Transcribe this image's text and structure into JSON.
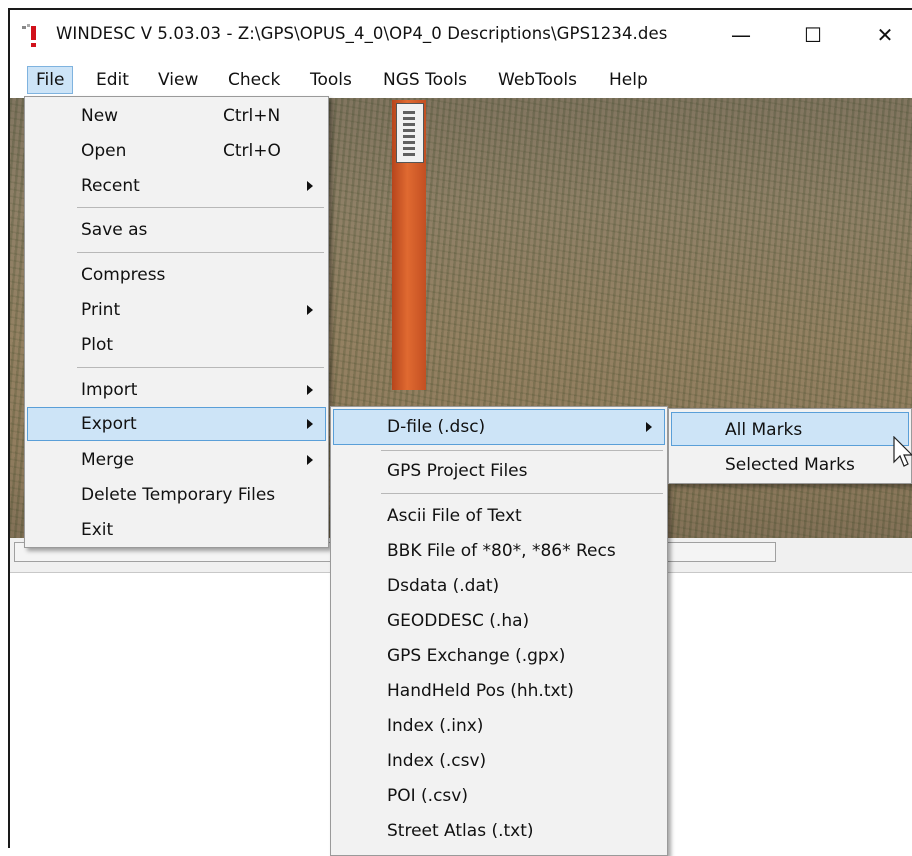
{
  "window": {
    "title": "WINDESC V 5.03.03 - Z:\\GPS\\OPUS_4_0\\OP4_0 Descriptions\\GPS1234.des",
    "icon": "app-exclamation-icon",
    "controls": {
      "minimize": "—",
      "maximize": "☐",
      "close": "✕"
    }
  },
  "menubar": {
    "items": [
      {
        "label": "File"
      },
      {
        "label": "Edit"
      },
      {
        "label": "View"
      },
      {
        "label": "Check"
      },
      {
        "label": "Tools"
      },
      {
        "label": "NGS Tools"
      },
      {
        "label": "WebTools"
      },
      {
        "label": "Help"
      }
    ]
  },
  "file_menu": {
    "items": [
      {
        "label": "New",
        "shortcut": "Ctrl+N"
      },
      {
        "label": "Open",
        "shortcut": "Ctrl+O"
      },
      {
        "label": "Recent"
      },
      {
        "label": "Save as"
      },
      {
        "label": "Compress"
      },
      {
        "label": "Print"
      },
      {
        "label": "Plot"
      },
      {
        "label": "Import"
      },
      {
        "label": "Export"
      },
      {
        "label": "Merge"
      },
      {
        "label": "Delete Temporary Files"
      },
      {
        "label": "Exit"
      }
    ]
  },
  "export_menu": {
    "items": [
      {
        "label": "D-file (.dsc)"
      },
      {
        "label": "GPS Project Files"
      },
      {
        "label": "Ascii File of Text"
      },
      {
        "label": "BBK File of *80*, *86* Recs"
      },
      {
        "label": "Dsdata (.dat)"
      },
      {
        "label": "GEODDESC (.ha)"
      },
      {
        "label": "GPS Exchange (.gpx)"
      },
      {
        "label": "HandHeld Pos (hh.txt)"
      },
      {
        "label": "Index (.inx)"
      },
      {
        "label": "Index (.csv)"
      },
      {
        "label": "POI (.csv)"
      },
      {
        "label": "Street Atlas (.txt)"
      }
    ]
  },
  "dfile_menu": {
    "items": [
      {
        "label": "All Marks"
      },
      {
        "label": "Selected Marks"
      }
    ]
  },
  "colors": {
    "highlight_fill": "#cde4f7",
    "highlight_border": "#5a9fd8",
    "post": "#e06a31"
  }
}
